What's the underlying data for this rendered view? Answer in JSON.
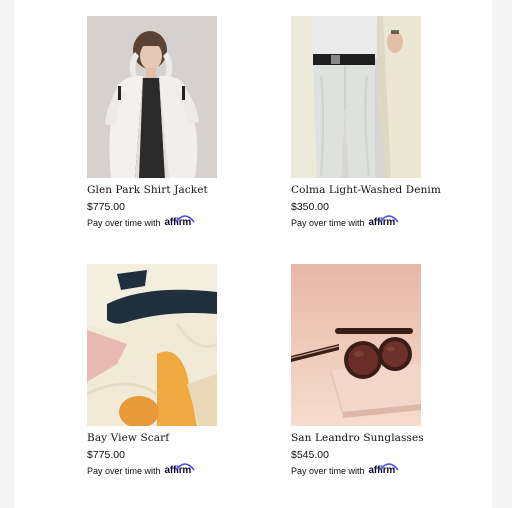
{
  "products": [
    {
      "name": "Glen Park Shirt Jacket",
      "price": "$775.00",
      "affirm_text": "Pay over time with",
      "affirm_brand": "affirm",
      "image": "model-white-jacket-photo"
    },
    {
      "name": "Colma Light-Washed Denim",
      "price": "$350.00",
      "affirm_text": "Pay over time with",
      "affirm_brand": "affirm",
      "image": "light-denim-jeans-photo"
    },
    {
      "name": "Bay View Scarf",
      "price": "$775.00",
      "affirm_text": "Pay over time with",
      "affirm_brand": "affirm",
      "image": "printed-silk-scarf-photo"
    },
    {
      "name": "San Leandro Sunglasses",
      "price": "$545.00",
      "affirm_text": "Pay over time with",
      "affirm_brand": "affirm",
      "image": "round-sunglasses-photo"
    }
  ],
  "colors": {
    "affirm_arc": "#4a4af4",
    "page_bg": "#f4f4f4",
    "card_bg": "#ffffff"
  }
}
